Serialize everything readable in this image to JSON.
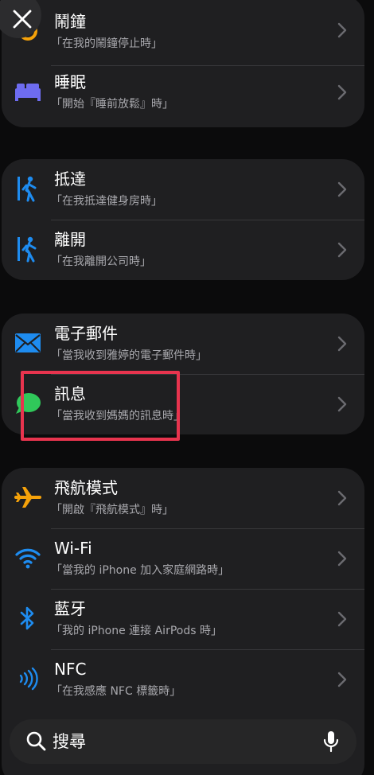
{
  "groups": [
    {
      "items": [
        {
          "title": "鬧鐘",
          "subtitle": "「在我的鬧鐘停止時」",
          "icon": "alarm-clock-icon"
        },
        {
          "title": "睡眠",
          "subtitle": "「開始『睡前放鬆』時」",
          "icon": "bed-icon"
        }
      ]
    },
    {
      "items": [
        {
          "title": "抵達",
          "subtitle": "「在我抵達健身房時」",
          "icon": "walking-arrive-icon"
        },
        {
          "title": "離開",
          "subtitle": "「在我離開公司時」",
          "icon": "walking-leave-icon"
        }
      ]
    },
    {
      "items": [
        {
          "title": "電子郵件",
          "subtitle": "「當我收到雅婷的電子郵件時」",
          "icon": "mail-icon"
        },
        {
          "title": "訊息",
          "subtitle": "「當我收到媽媽的訊息時」",
          "icon": "message-bubble-icon"
        }
      ]
    },
    {
      "items": [
        {
          "title": "飛航模式",
          "subtitle": "「開啟『飛航模式』時」",
          "icon": "airplane-icon"
        },
        {
          "title": "Wi-Fi",
          "subtitle": "「當我的 iPhone 加入家庭網路時」",
          "icon": "wifi-icon"
        },
        {
          "title": "藍牙",
          "subtitle": "「我的 iPhone 連接 AirPods 時」",
          "icon": "bluetooth-icon"
        },
        {
          "title": "NFC",
          "subtitle": "「在我感應 NFC 標籤時」",
          "icon": "nfc-icon"
        }
      ]
    }
  ],
  "search": {
    "label": "搜尋"
  },
  "colors": {
    "accent_blue": "#1e8cf0",
    "orange": "#f5a20a",
    "green": "#30c85a",
    "purple": "#6e6cf0",
    "highlight": "#e8344e"
  }
}
